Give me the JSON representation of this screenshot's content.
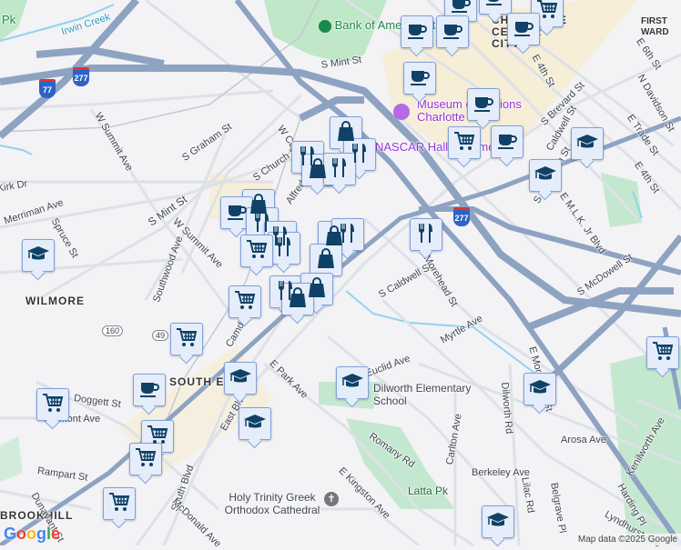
{
  "map": {
    "neighborhoods": [
      "WILMORE",
      "SOUTH END",
      "BROOKHILL",
      "CHARLOTTE CENTER CITY",
      "FIRST WARD"
    ],
    "streets": [
      "S Mint St",
      "S Mint St",
      "W Summit Ave",
      "W Summit Ave",
      "S Graham St",
      "S Church St",
      "W Carson Blvd",
      "Alfred St",
      "Merriman Ave",
      "Spruce St",
      "Southwood Ave",
      "Camden Rd",
      "Doggett St",
      "Fremont Ave",
      "Rampart St",
      "Dunavant St",
      "South Blvd",
      "McDonald Ave",
      "E Park Ave",
      "East Blvd",
      "Euclid Ave",
      "S Caldwell St",
      "Myrtle Ave",
      "Dilworth Rd",
      "Carlton Ave",
      "Romany Rd",
      "E Kingston Ave",
      "Berkeley Ave",
      "Arosa Ave",
      "Kenilworth Ave",
      "Harding Pl",
      "Lilac Rd",
      "Belgrave Pl",
      "Lyndhurst Ave",
      "E Morehead St",
      "E Morehead St",
      "S McDowell St",
      "E M.L.K. Jr Blvd",
      "S Davidson St",
      "Caldwell St",
      "S Brevard St",
      "E 4th St",
      "E 4th St",
      "E Trade St",
      "E 6th St",
      "N Davidson St",
      "Irwin Creek",
      "Kirk Dr"
    ],
    "pois": {
      "bank": "Bank of America Stadium",
      "museum": "Museum of Illusions Charlotte",
      "nascar": "NASCAR Hall of Fame",
      "school": "Dilworth Elementary School",
      "park": "Latta Pk",
      "church": "Holy Trinity Greek Orthodox Cathedral",
      "park2": "Pk"
    },
    "shields": [
      "77",
      "277",
      "277"
    ],
    "route_badges": [
      "160",
      "49"
    ],
    "markers": [
      "coffee",
      "coffee",
      "coffee",
      "coffee",
      "cart",
      "coffee",
      "coffee",
      "coffee",
      "cart",
      "coffee",
      "school",
      "school",
      "bag",
      "restaurant",
      "restaurant",
      "bag",
      "restaurant",
      "bag",
      "coffee",
      "restaurant",
      "restaurant",
      "restaurant",
      "cart",
      "bag",
      "restaurant",
      "bag",
      "restaurant",
      "school",
      "restaurant",
      "bag",
      "bag",
      "cart",
      "cart",
      "school",
      "coffee",
      "school",
      "cart",
      "school",
      "school",
      "cart",
      "cart",
      "cart",
      "school",
      "cart"
    ],
    "attribution": "Map data ©2025 Google",
    "logo": "Google"
  },
  "colors": {
    "highway": "#8ea3c2",
    "street": "#dde1e8",
    "park": "#c4e8cf",
    "downtown": "#f6eed7",
    "water": "#8fd3ef",
    "marker_icon": "#0f4266",
    "marker_bg": "#e5edfb"
  }
}
